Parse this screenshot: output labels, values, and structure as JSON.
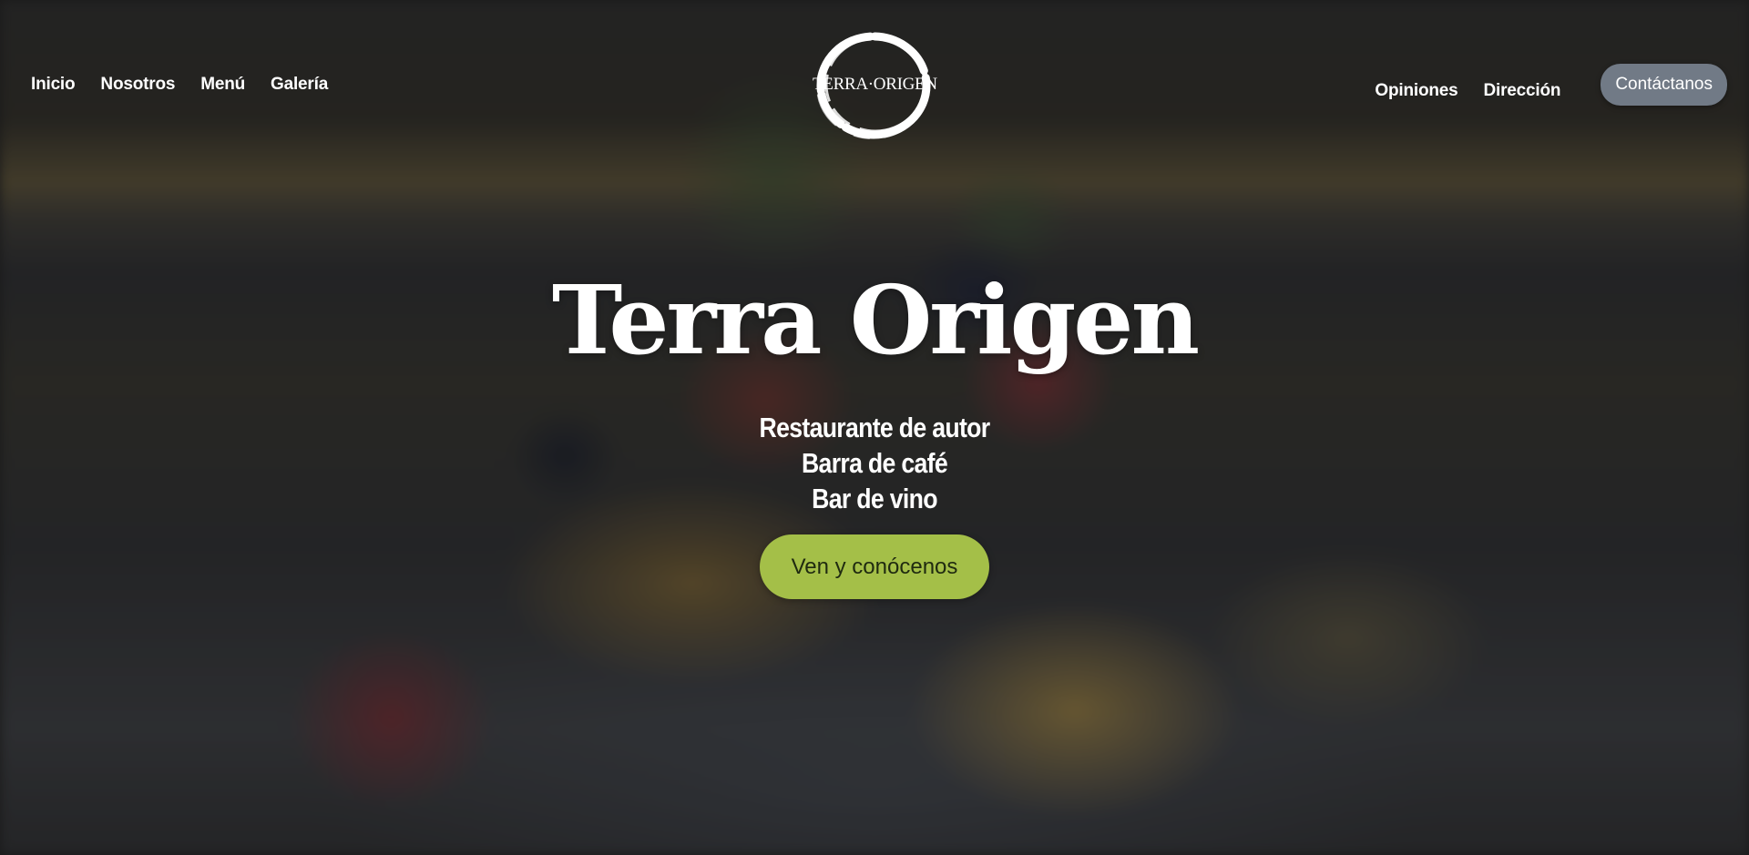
{
  "nav": {
    "left": [
      {
        "label": "Inicio"
      },
      {
        "label": "Nosotros"
      },
      {
        "label": "Menú"
      },
      {
        "label": "Galería"
      }
    ],
    "right": [
      {
        "label": "Opiniones"
      },
      {
        "label": "Dirección"
      }
    ],
    "contact_label": "Contáctanos"
  },
  "logo": {
    "text": "TERRA·ORIGEN",
    "icon": "brush-circle-logo"
  },
  "hero": {
    "title": "Terra Origen",
    "subtitle_lines": [
      "Restaurante de autor",
      "Barra de café",
      "Bar de vino"
    ],
    "cta_label": "Ven y conócenos"
  },
  "colors": {
    "cta_background": "#a4bf48",
    "contact_background": "#717a86",
    "text": "#ffffff"
  }
}
